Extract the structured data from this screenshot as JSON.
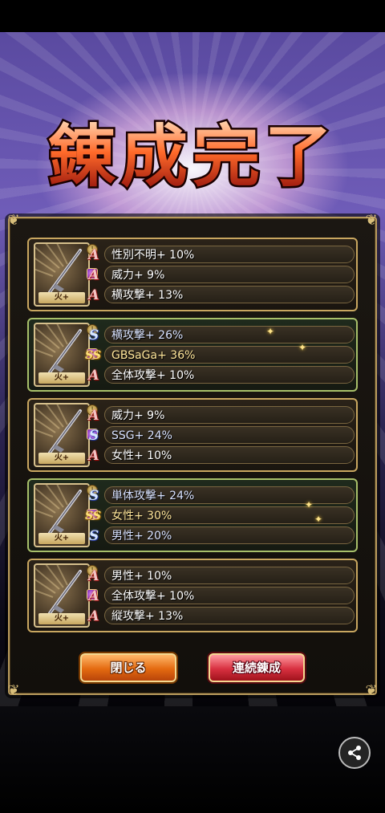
{
  "title": "錬成完了",
  "cards": [
    {
      "weapon_label": "火+",
      "rows": [
        {
          "grade": "A",
          "text": "性別不明+ 10%"
        },
        {
          "grade": "A",
          "text": "威力+ 9%"
        },
        {
          "grade": "A",
          "text": "横攻撃+ 13%"
        }
      ]
    },
    {
      "weapon_label": "火+",
      "rows": [
        {
          "grade": "S",
          "text": "横攻撃+ 26%"
        },
        {
          "grade": "SS",
          "text": "GBSaGa+ 36%"
        },
        {
          "grade": "A",
          "text": "全体攻撃+ 10%"
        }
      ]
    },
    {
      "weapon_label": "火+",
      "rows": [
        {
          "grade": "A",
          "text": "威力+ 9%"
        },
        {
          "grade": "S",
          "text": "SSG+ 24%"
        },
        {
          "grade": "A",
          "text": "女性+ 10%"
        }
      ]
    },
    {
      "weapon_label": "火+",
      "rows": [
        {
          "grade": "S",
          "text": "単体攻撃+ 24%"
        },
        {
          "grade": "SS",
          "text": "女性+ 30%"
        },
        {
          "grade": "S",
          "text": "男性+ 20%"
        }
      ]
    },
    {
      "weapon_label": "火+",
      "rows": [
        {
          "grade": "A",
          "text": "男性+ 10%"
        },
        {
          "grade": "A",
          "text": "全体攻撃+ 10%"
        },
        {
          "grade": "A",
          "text": "縦攻撃+ 13%"
        }
      ]
    }
  ],
  "buttons": {
    "close_label": "閉じる",
    "again_label": "連続錬成"
  },
  "colors": {
    "grade_A": "#c01818",
    "grade_S": "#3a5cd0",
    "grade_SS": "#d08a10",
    "close_button": "#e46a10",
    "again_button": "#d83040",
    "frame_gold": "#c9a760"
  },
  "icons": {
    "share": "share-icon",
    "weapon": "gun-icon"
  }
}
